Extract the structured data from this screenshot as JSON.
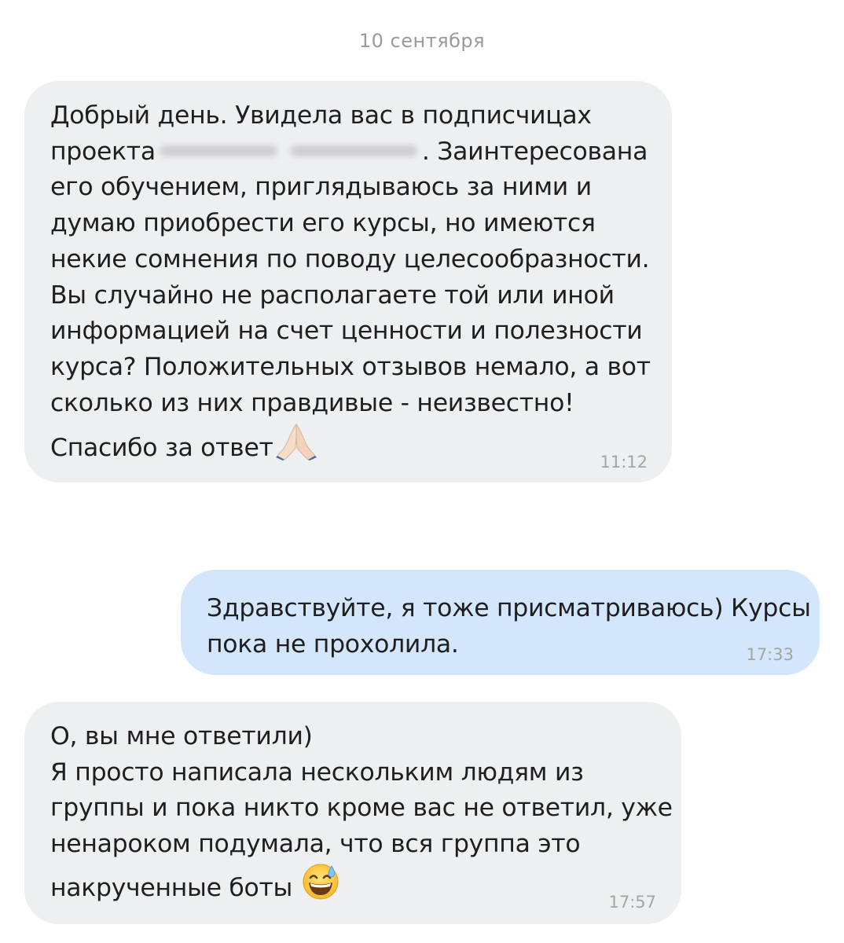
{
  "conversation": {
    "date_separator": "10 сентября",
    "messages": [
      {
        "direction": "incoming",
        "lines": [
          "Добрый день. Увидела вас в подписчицах",
          "проекта",
          ". Заинтересована",
          "его обучением,  приглядываюсь за ними и",
          "думаю приобрести его курсы, но имеются",
          "некие сомнения по поводу целесообразности.",
          "Вы случайно не располагаете той или иной",
          "информацией на счет ценности и полезности",
          "курса? Положительных отзывов немало, а вот",
          "сколько из них правдивые - неизвестно!",
          "Спасибо за ответ"
        ],
        "emoji": "folded-hands-icon",
        "time": "11:12"
      },
      {
        "direction": "outgoing",
        "lines": [
          "Здравствуйте, я тоже присматриваюсь) Курсы",
          "пока не прохолила."
        ],
        "time": "17:33"
      },
      {
        "direction": "incoming",
        "lines": [
          "О, вы мне ответили)",
          "Я просто написала нескольким людям из",
          "группы и пока никто кроме вас не ответил, уже",
          "ненароком подумала, что вся группа это",
          "накрученные боты"
        ],
        "emoji": "grinning-sweat-face-icon",
        "time": "17:57"
      }
    ]
  },
  "colors": {
    "incoming_bubble": "#eeeff1",
    "outgoing_bubble": "#d4e6fc",
    "timestamp": "#a5a5a5",
    "date_separator": "#9a9a9a"
  }
}
